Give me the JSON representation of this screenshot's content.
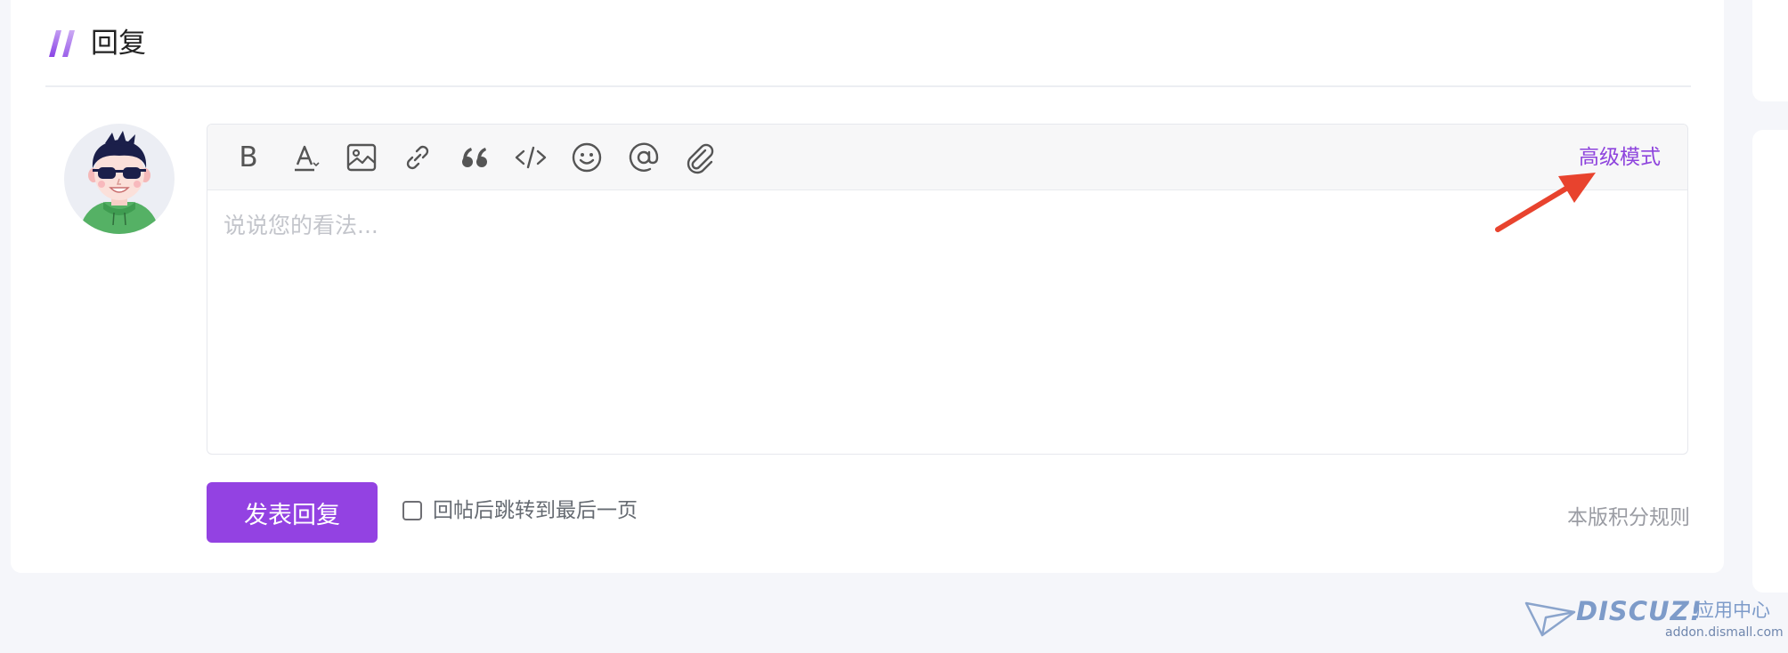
{
  "reply_section": {
    "title": "回复",
    "editor": {
      "toolbar": {
        "tools": [
          {
            "icon": "bold-icon",
            "label": "B"
          },
          {
            "icon": "font-color-icon"
          },
          {
            "icon": "image-icon"
          },
          {
            "icon": "link-icon"
          },
          {
            "icon": "quote-icon"
          },
          {
            "icon": "code-icon"
          },
          {
            "icon": "emoji-icon"
          },
          {
            "icon": "at-mention-icon"
          },
          {
            "icon": "attachment-icon"
          }
        ],
        "advanced_mode_label": "高级模式"
      },
      "placeholder": "说说您的看法..."
    },
    "submit_label": "发表回复",
    "jump_to_last_page": {
      "label": "回帖后跳转到最后一页",
      "checked": false
    },
    "rules_link": "本版积分规则"
  },
  "watermark": {
    "brand": "DISCUZ!",
    "subtitle": "应用中心",
    "url": "addon.dismall.com"
  },
  "colors": {
    "accent": "#9342e2",
    "link_accent": "#8e44dd",
    "annotation_arrow": "#e8432e",
    "background": "#f5f6fa"
  }
}
